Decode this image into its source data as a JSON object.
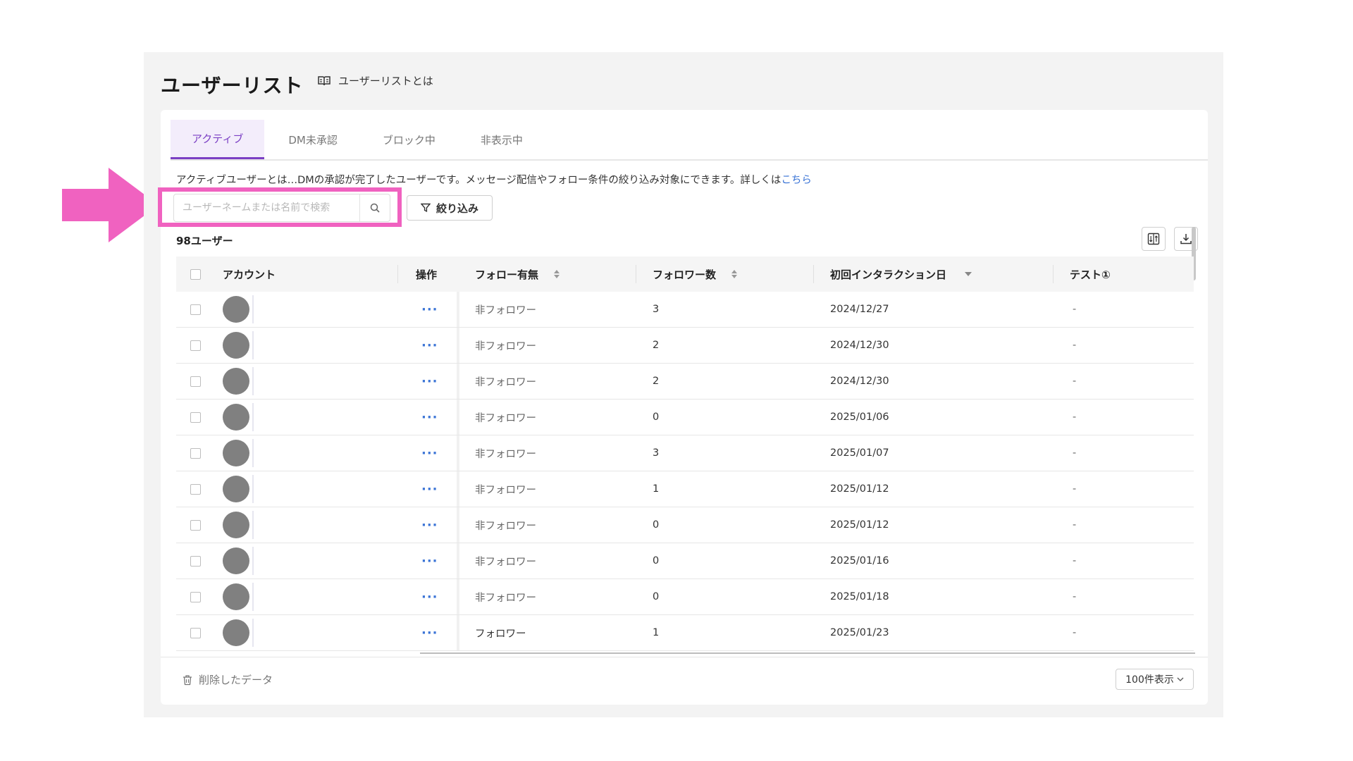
{
  "page": {
    "title": "ユーザーリスト",
    "help_label": "ユーザーリストとは"
  },
  "tabs": [
    {
      "label": "アクティブ",
      "active": true
    },
    {
      "label": "DM未承認",
      "active": false
    },
    {
      "label": "ブロック中",
      "active": false
    },
    {
      "label": "非表示中",
      "active": false
    }
  ],
  "description": {
    "text": "アクティブユーザーとは…DMの承認が完了したユーザーです。メッセージ配信やフォロー条件の絞り込み対象にできます。詳しくは",
    "link": "こちら"
  },
  "search": {
    "placeholder": "ユーザーネームまたは名前で検索",
    "value": ""
  },
  "filter_label": "絞り込み",
  "user_count": "98ユーザー",
  "table": {
    "columns": {
      "account": "アカウント",
      "operations": "操作",
      "follow_status": "フォロー有無",
      "followers": "フォロワー数",
      "first_interaction": "初回インタラクション日",
      "test": "テスト①"
    },
    "rows": [
      {
        "ops": "···",
        "follow": "非フォロワー",
        "followers": "3",
        "date": "2024/12/27",
        "test": "-"
      },
      {
        "ops": "···",
        "follow": "非フォロワー",
        "followers": "2",
        "date": "2024/12/30",
        "test": "-"
      },
      {
        "ops": "···",
        "follow": "非フォロワー",
        "followers": "2",
        "date": "2024/12/30",
        "test": "-"
      },
      {
        "ops": "···",
        "follow": "非フォロワー",
        "followers": "0",
        "date": "2025/01/06",
        "test": "-"
      },
      {
        "ops": "···",
        "follow": "非フォロワー",
        "followers": "3",
        "date": "2025/01/07",
        "test": "-"
      },
      {
        "ops": "···",
        "follow": "非フォロワー",
        "followers": "1",
        "date": "2025/01/12",
        "test": "-"
      },
      {
        "ops": "···",
        "follow": "非フォロワー",
        "followers": "0",
        "date": "2025/01/12",
        "test": "-"
      },
      {
        "ops": "···",
        "follow": "非フォロワー",
        "followers": "0",
        "date": "2025/01/16",
        "test": "-"
      },
      {
        "ops": "···",
        "follow": "非フォロワー",
        "followers": "0",
        "date": "2025/01/18",
        "test": "-"
      },
      {
        "ops": "···",
        "follow": "フォロワー",
        "followers": "1",
        "date": "2025/01/23",
        "test": "-"
      }
    ]
  },
  "footer": {
    "deleted_label": "削除したデータ",
    "page_size_label": "100件表示"
  },
  "colors": {
    "accent": "#7b3fc4",
    "link": "#3b74d6",
    "highlight": "#f062c0"
  }
}
